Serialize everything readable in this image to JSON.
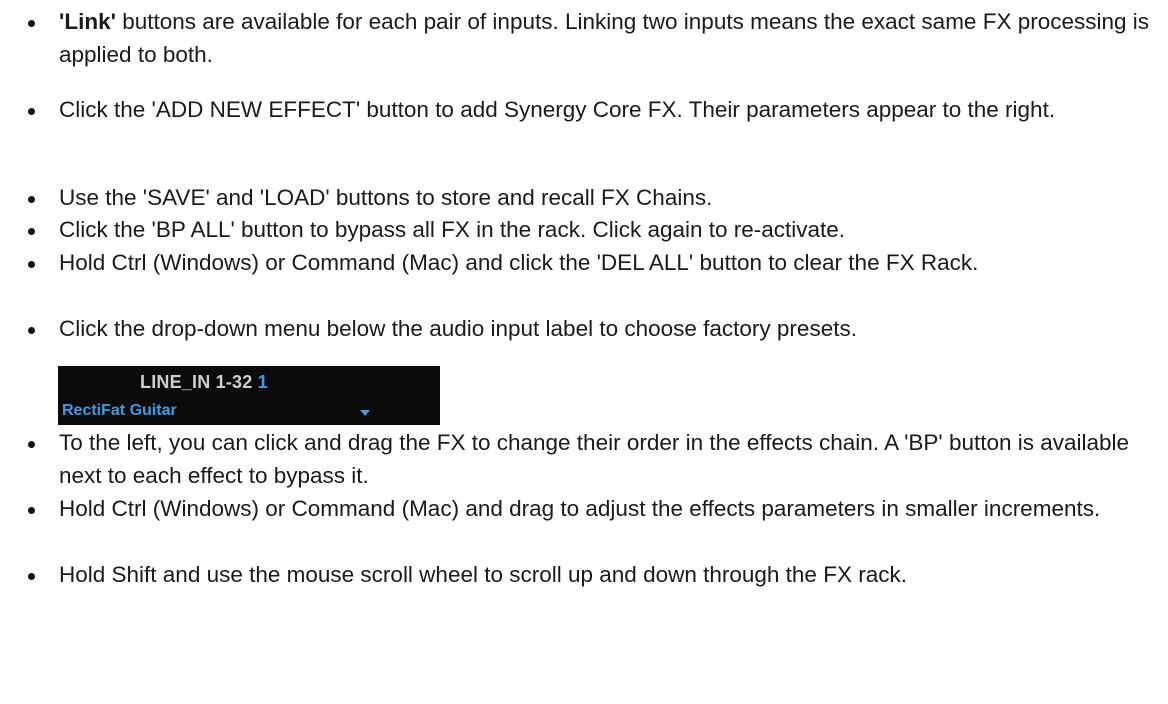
{
  "bullets": [
    {
      "strong": "'Link'",
      "text": " buttons are available for each pair of inputs. Linking two inputs means the exact same FX processing is applied to both."
    },
    {
      "text": "Click the 'ADD NEW EFFECT' button to add Synergy Core FX. Their parameters appear to the right."
    },
    {
      "text": "Use the 'SAVE' and 'LOAD' buttons to store and recall FX Chains."
    },
    {
      "text": "Click the 'BP ALL' button to bypass all FX in the rack. Click again to re-activate."
    },
    {
      "text": "Hold Ctrl (Windows) or Command (Mac) and click the 'DEL ALL' button to clear the FX Rack."
    },
    {
      "text": "Click the drop-down menu below the audio input label to choose factory presets."
    },
    {
      "text": "To the left, you can click and drag the FX to change their order in the effects chain. A 'BP' button is available next to each effect to bypass it."
    },
    {
      "text": "Hold Ctrl (Windows) or Command (Mac) and drag to adjust the effects parameters in smaller increments."
    },
    {
      "text": "Hold Shift and use the mouse scroll wheel to scroll up and down through the FX rack."
    }
  ],
  "ui_image": {
    "input_label": "LINE_IN 1-32",
    "input_number": "1",
    "preset_value": "RectiFat Guitar",
    "dropdown_icon": "chevron-down-icon",
    "accent_color": "#3b9de6",
    "background_color": "#0b0b0b"
  }
}
